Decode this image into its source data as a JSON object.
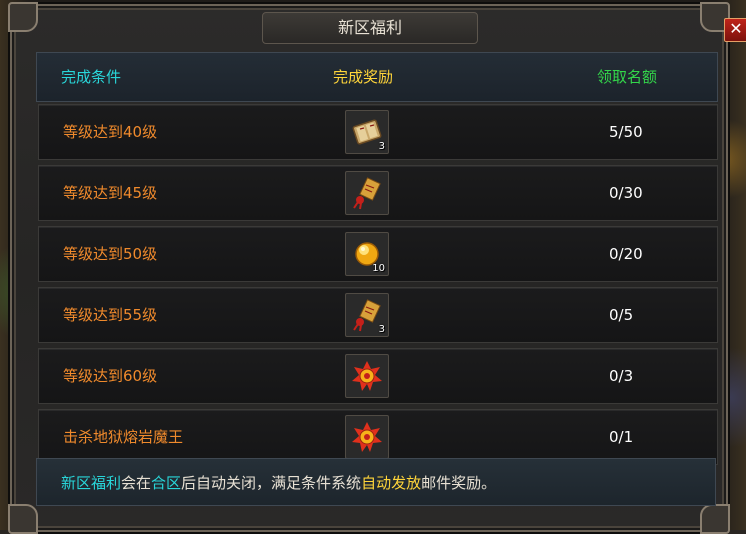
{
  "window": {
    "title": "新区福利",
    "close_label": "✕"
  },
  "header": {
    "condition": "完成条件",
    "reward": "完成奖励",
    "quota": "领取名额"
  },
  "rows": [
    {
      "condition": "等级达到40级",
      "reward_icon": "book-icon",
      "reward_count": "3",
      "quota": "5/50"
    },
    {
      "condition": "等级达到45级",
      "reward_icon": "scroll-charm-icon",
      "reward_count": "",
      "quota": "0/30"
    },
    {
      "condition": "等级达到50级",
      "reward_icon": "gold-orb-icon",
      "reward_count": "10",
      "quota": "0/20"
    },
    {
      "condition": "等级达到55级",
      "reward_icon": "scroll-charm-icon",
      "reward_count": "3",
      "quota": "0/5"
    },
    {
      "condition": "等级达到60级",
      "reward_icon": "red-emblem-icon",
      "reward_count": "",
      "quota": "0/3"
    },
    {
      "condition": "击杀地狱熔岩魔王",
      "reward_icon": "red-emblem-icon",
      "reward_count": "",
      "quota": "0/1"
    }
  ],
  "footer": {
    "part1": "新区福利",
    "part2": "会在",
    "part3": "合区",
    "part4": "后自动关闭，满足条件系统",
    "part5": "自动发放",
    "part6": "邮件奖励。"
  },
  "colors": {
    "condition": "#f08a2c",
    "highlight_cyan": "#29d6d9",
    "highlight_yellow": "#ffd53a",
    "quota_header": "#33d64a"
  }
}
